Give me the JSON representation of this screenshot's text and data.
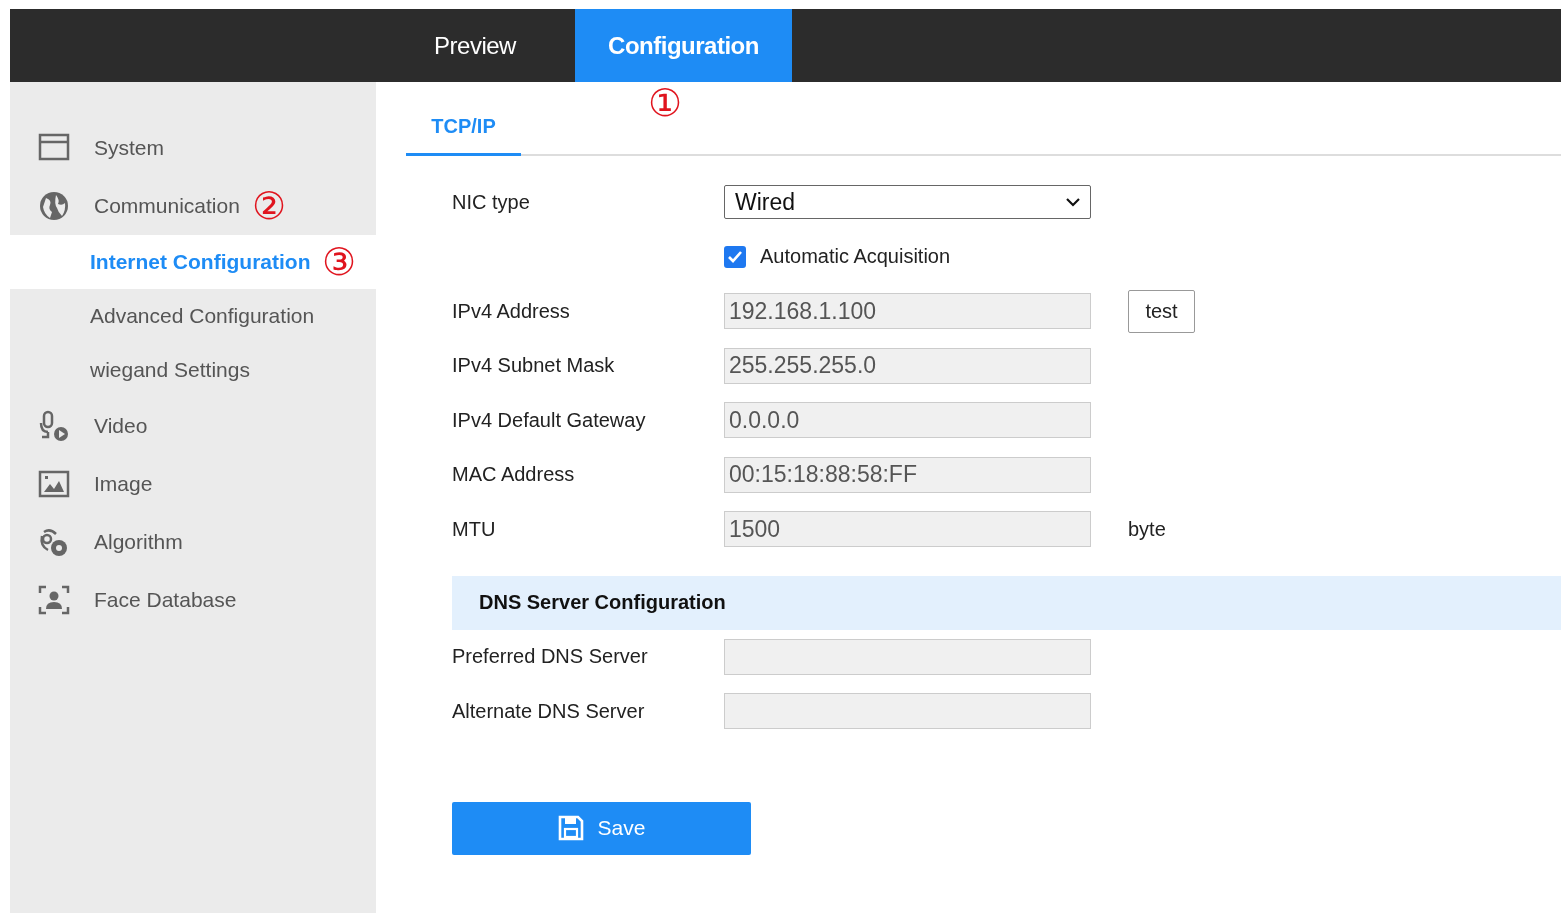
{
  "header": {
    "tabs": [
      {
        "label": "Preview",
        "selected": false
      },
      {
        "label": "Configuration",
        "selected": true
      }
    ]
  },
  "sidebar": {
    "items": [
      {
        "label": "System",
        "selected": false
      },
      {
        "label": "Communication",
        "selected": false,
        "annotation": "②",
        "children": [
          {
            "label": "Internet Configuration",
            "selected": true,
            "annotation": "③"
          },
          {
            "label": "Advanced Configuration",
            "selected": false
          },
          {
            "label": "wiegand Settings",
            "selected": false
          }
        ]
      },
      {
        "label": "Video",
        "selected": false
      },
      {
        "label": "Image",
        "selected": false
      },
      {
        "label": "Algorithm",
        "selected": false
      },
      {
        "label": "Face Database",
        "selected": false
      }
    ]
  },
  "content": {
    "tabs": [
      {
        "label": "TCP/IP",
        "selected": true
      }
    ],
    "annotation": "①",
    "fields": [
      {
        "kind": "select",
        "label": "NIC type",
        "value": "Wired"
      },
      {
        "kind": "checkbox",
        "label": "Automatic Acquisition",
        "checked": true
      },
      {
        "kind": "text",
        "label": "IPv4 Address",
        "value": "192.168.1.100",
        "disabled": true,
        "button": "test"
      },
      {
        "kind": "text",
        "label": "IPv4 Subnet Mask",
        "value": "255.255.255.0",
        "disabled": true
      },
      {
        "kind": "text",
        "label": "IPv4 Default Gateway",
        "value": "0.0.0.0",
        "disabled": true
      },
      {
        "kind": "text",
        "label": "MAC Address",
        "value": "00:15:18:88:58:FF",
        "disabled": true
      },
      {
        "kind": "text",
        "label": "MTU",
        "value": "1500",
        "disabled": true,
        "unit": "byte"
      }
    ],
    "dns_section": {
      "title": "DNS Server Configuration",
      "fields": [
        {
          "kind": "text",
          "label": "Preferred DNS Server",
          "disabled": true
        },
        {
          "kind": "text",
          "label": "Alternate DNS Server",
          "disabled": true
        }
      ]
    },
    "save_button": "Save"
  }
}
